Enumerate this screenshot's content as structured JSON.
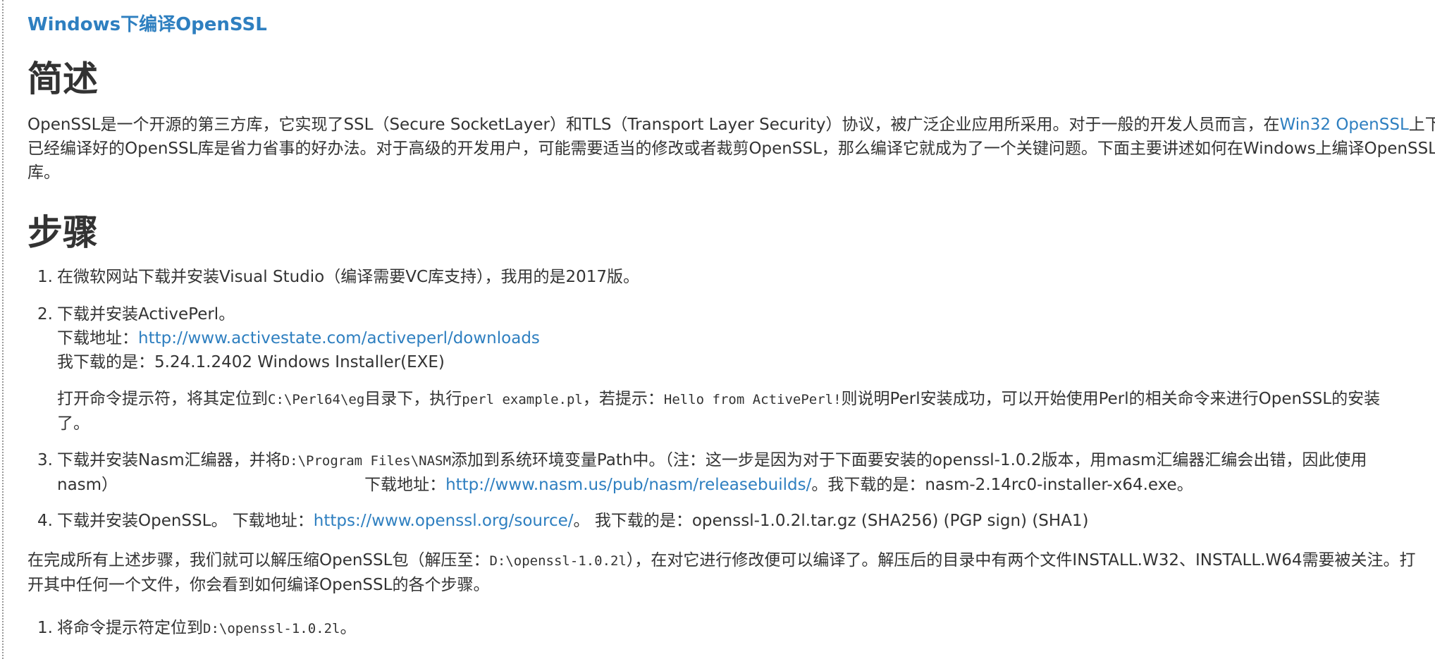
{
  "title": "Windows下编译OpenSSL",
  "section1": {
    "heading": "简述",
    "p_line1_a": "OpenSSL是一个开源的第三方库，它实现了SSL（Secure SocketLayer）和TLS（Transport Layer Security）协议，被广泛企业应用所采用。对于一般的开发人员而言，在",
    "p_line1_link": "Win32 OpenSSL",
    "p_line1_b": "上下载",
    "p_line2": "已经编译好的OpenSSL库是省力省事的好办法。对于高级的开发用户，可能需要适当的修改或者裁剪OpenSSL，那么编译它就成为了一个关键问题。下面主要讲述如何在Windows上编译OpenSSL",
    "p_line3": "库。"
  },
  "section2": {
    "heading": "步骤",
    "steps": [
      {
        "num": "1.",
        "text": "在微软网站下载并安装Visual Studio（编译需要VC库支持），我用的是2017版。"
      },
      {
        "num": "2.",
        "line1": "下载并安装ActivePerl。",
        "line2_label": "下载地址：",
        "line2_link": "http://www.activestate.com/activeperl/downloads",
        "line3": "我下载的是：5.24.1.2402 Windows Installer(EXE)",
        "sub_a": "打开命令提示符，将其定位到",
        "sub_code1": "C:\\Perl64\\eg",
        "sub_b": "目录下，执行",
        "sub_code2": "perl example.pl",
        "sub_c": "，若提示：",
        "sub_code3": "Hello from ActivePerl!",
        "sub_d": "则说明Perl安装成功，可以开始使用Perl的相关命令来进行OpenSSL的安装",
        "sub_line2": "了。"
      },
      {
        "num": "3.",
        "a": "下载并安装Nasm汇编器，并将",
        "code": "D:\\Program Files\\NASM",
        "b": "添加到系统环境变量Path中。（注：这一步是因为对于下面要安装的openssl-1.0.2版本，用masm汇编器汇编会出错，因此使用",
        "line2_a": "nasm）",
        "line2_label": "下载地址：",
        "line2_link": "http://www.nasm.us/pub/nasm/releasebuilds/",
        "line2_b": "。我下载的是：nasm-2.14rc0-installer-x64.exe。"
      },
      {
        "num": "4.",
        "a": "下载并安装OpenSSL。 下载地址：",
        "link": "https://www.openssl.org/source/",
        "b": "。 我下载的是：openssl-1.0.2l.tar.gz (SHA256) (PGP sign) (SHA1)"
      }
    ],
    "p2_a": "在完成所有上述步骤，我们就可以解压缩OpenSSL包（解压至：",
    "p2_code": "D:\\openssl-1.0.2l",
    "p2_b": "），在对它进行修改便可以编译了。解压后的目录中有两个文件INSTALL.W32、INSTALL.W64需要被关注。打",
    "p2_line2": "开其中任何一个文件，你会看到如何编译OpenSSL的各个步骤。",
    "sub_steps": [
      {
        "num": "1.",
        "a": "将命令提示符定位到",
        "code": "D:\\openssl-1.0.2l",
        "b": "。"
      }
    ]
  },
  "colors": {
    "link": "#2e7fc0",
    "text": "#333333",
    "background": "#ffffff"
  }
}
